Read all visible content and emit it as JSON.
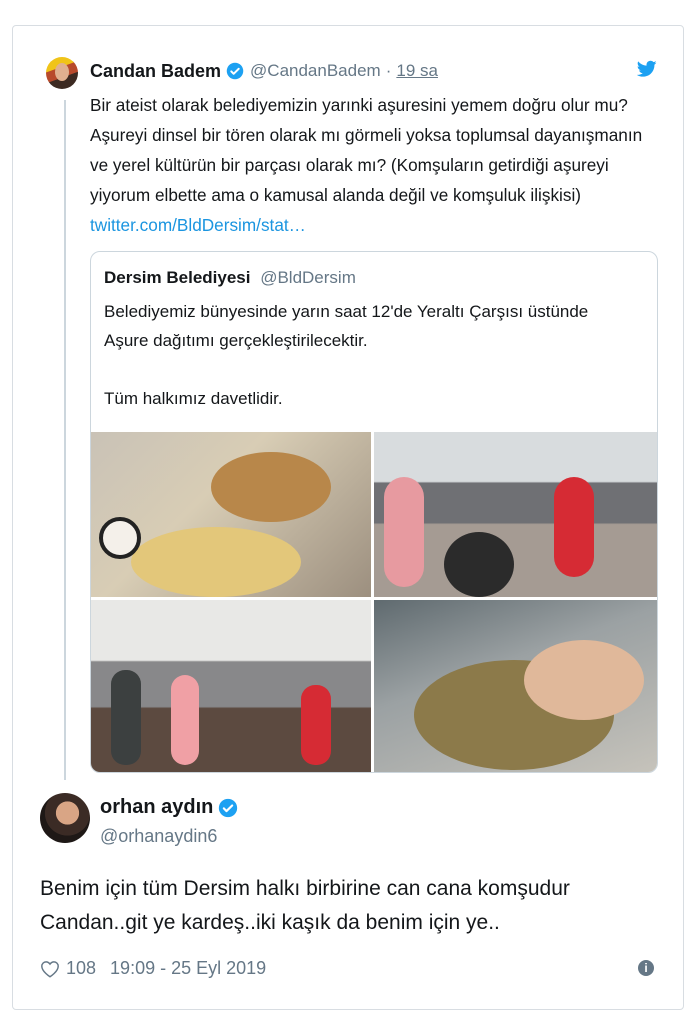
{
  "tweet": {
    "author_name": "Candan Badem",
    "author_handle": "@CandanBadem",
    "separator": "·",
    "time": "19 sa",
    "text": "Bir ateist olarak belediyemizin yarınki aşuresini yemem doğru olur mu? Aşureyi dinsel bir tören olarak mı görmeli yoksa toplumsal dayanışmanın ve yerel kültürün bir parçası olarak mı? (Komşuların getirdiği aşureyi yiyorum elbette ama o kamusal alanda değil ve komşuluk ilişkisi) ",
    "link": "twitter.com/BldDersim/stat…"
  },
  "quoted": {
    "author_name": "Dersim Belediyesi",
    "author_handle": "@BldDersim",
    "line1": "Belediyemiz bünyesinde yarın saat 12'de Yeraltı Çarşısı üstünde",
    "line2": "Aşure dağıtımı gerçekleştirilecektir.",
    "line3": "Tüm halkımız davetlidir."
  },
  "reply": {
    "author_name": "orhan aydın",
    "author_handle": "@orhanaydin6",
    "text": "Benim için tüm Dersim halkı birbirine can cana komşudur Candan..git ye kardeş..iki kaşık da benim için ye..",
    "likes": "108",
    "timestamp": "19:09 - 25 Eyl 2019"
  },
  "icons": {
    "verified": "verified-badge-icon",
    "bird": "twitter-bird-icon",
    "heart": "heart-icon",
    "info": "info-icon"
  },
  "colors": {
    "link": "#1b95e0",
    "verified": "#1da1f2",
    "muted": "#657786",
    "text": "#14171a"
  }
}
